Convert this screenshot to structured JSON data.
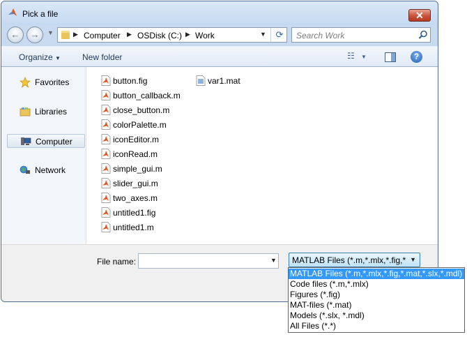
{
  "window": {
    "title": "Pick a file",
    "close_glyph": "✕"
  },
  "nav": {
    "back_glyph": "←",
    "forward_glyph": "→",
    "breadcrumb": [
      "Computer",
      "OSDisk (C:)",
      "Work"
    ],
    "refresh_glyph": "⟳",
    "search_placeholder": "Search Work"
  },
  "toolbar": {
    "organize": "Organize",
    "new_folder": "New folder",
    "help_glyph": "?"
  },
  "sidebar": {
    "items": [
      {
        "label": "Favorites",
        "icon": "star-icon"
      },
      {
        "label": "Libraries",
        "icon": "libraries-icon"
      },
      {
        "label": "Computer",
        "icon": "computer-icon",
        "selected": true
      },
      {
        "label": "Network",
        "icon": "network-icon"
      }
    ]
  },
  "files": {
    "column1": [
      "button.fig",
      "button_callback.m",
      "close_button.m",
      "colorPalette.m",
      "iconEditor.m",
      "iconRead.m",
      "simple_gui.m",
      "slider_gui.m",
      "two_axes.m",
      "untitled1.fig",
      "untitled1.m"
    ],
    "column2": [
      "var1.mat"
    ]
  },
  "footer": {
    "file_name_label": "File name:",
    "file_name_value": "",
    "filter_selected": "MATLAB Files (*.m,*.mlx,*.fig,*.mat,*.slx,*.mdl)",
    "filter_options": [
      "MATLAB Files (*.m,*.mlx,*.fig,*.mat,*.slx,*.mdl)",
      "Code files (*.m,*.mlx)",
      "Figures (*.fig)",
      "MAT-files (*.mat)",
      "Models (*.slx, *.mdl)",
      "All Files (*.*)"
    ]
  },
  "colors": {
    "selection": "#3399ff",
    "window_frame": "#c7daf0",
    "close": "#c9513a"
  }
}
